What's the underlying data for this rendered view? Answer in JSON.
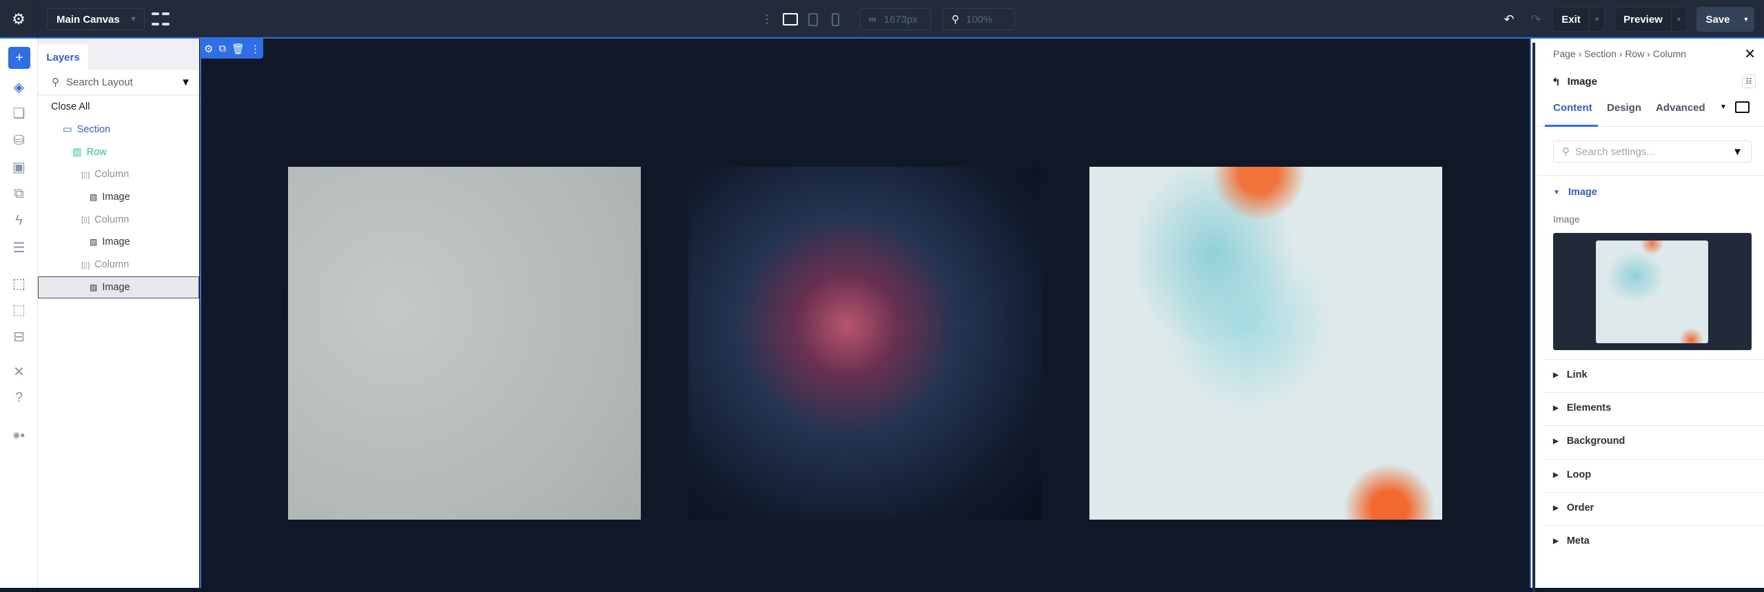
{
  "topbar": {
    "canvas_select": "Main Canvas",
    "width_value": "1673px",
    "zoom_value": "100%",
    "exit_label": "Exit",
    "preview_label": "Preview",
    "save_label": "Save"
  },
  "layers": {
    "tab": "Layers",
    "search_placeholder": "Search Layout",
    "close_all": "Close All",
    "tree": [
      {
        "label": "Section",
        "type": "section"
      },
      {
        "label": "Row",
        "type": "row"
      },
      {
        "label": "Column",
        "type": "column"
      },
      {
        "label": "Image",
        "type": "image"
      },
      {
        "label": "Column",
        "type": "column"
      },
      {
        "label": "Image",
        "type": "image"
      },
      {
        "label": "Column",
        "type": "column"
      },
      {
        "label": "Image",
        "type": "image",
        "selected": true
      }
    ]
  },
  "settings": {
    "breadcrumb": [
      "Page",
      "Section",
      "Row",
      "Column"
    ],
    "title": "Image",
    "tabs": [
      "Content",
      "Design",
      "Advanced"
    ],
    "active_tab": "Content",
    "search_placeholder": "Search settings...",
    "open_section": "Image",
    "field_label": "Image",
    "sections": [
      "Link",
      "Elements",
      "Background",
      "Loop",
      "Order",
      "Meta"
    ]
  },
  "colors": {
    "accent": "#2f6fe6",
    "canvas_bg": "#101727",
    "topbar_bg": "#222b3a"
  }
}
